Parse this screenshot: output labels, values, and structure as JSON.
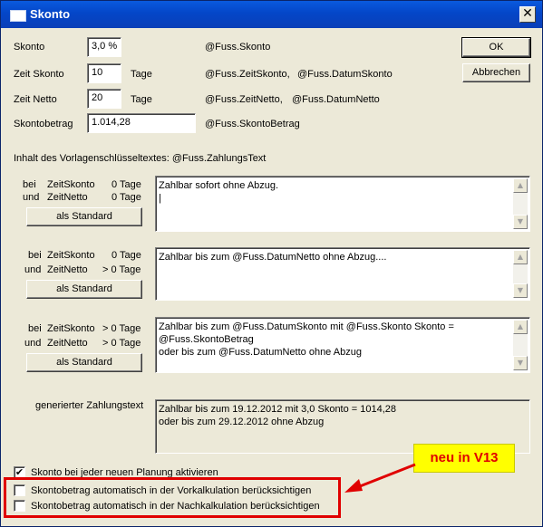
{
  "window": {
    "title": "Skonto",
    "close_glyph": "✕"
  },
  "fields": {
    "skonto": {
      "label": "Skonto",
      "value": "3,0 %",
      "var": "@Fuss.Skonto"
    },
    "zeit_skonto": {
      "label": "Zeit Skonto",
      "value": "10",
      "unit": "Tage",
      "var1": "@Fuss.ZeitSkonto,",
      "var2": "@Fuss.DatumSkonto"
    },
    "zeit_netto": {
      "label": "Zeit Netto",
      "value": "20",
      "unit": "Tage",
      "var1": "@Fuss.ZeitNetto,",
      "var2": "@Fuss.DatumNetto"
    },
    "skontobetrag": {
      "label": "Skontobetrag",
      "value": "1.014,28",
      "var": "@Fuss.SkontoBetrag"
    }
  },
  "buttons": {
    "ok": "OK",
    "cancel": "Abbrechen"
  },
  "inhalt_label": "Inhalt des Vorlagenschlüsseltextes: @Fuss.ZahlungsText",
  "blocks": [
    {
      "bei": "bei",
      "und": "und",
      "cond1_name": "ZeitSkonto",
      "cond1_value": "0 Tage",
      "cond2_name": "ZeitNetto",
      "cond2_value": "0 Tage",
      "button": "als Standard",
      "text": "Zahlbar sofort ohne Abzug.\n|"
    },
    {
      "bei": "bei",
      "und": "und",
      "cond1_name": "ZeitSkonto",
      "cond1_value": "0 Tage",
      "cond2_name": "ZeitNetto",
      "cond2_value": "> 0 Tage",
      "button": "als Standard",
      "text": "Zahlbar bis zum @Fuss.DatumNetto ohne Abzug...."
    },
    {
      "bei": "bei",
      "und": "und",
      "cond1_name": "ZeitSkonto",
      "cond1_value": "> 0 Tage",
      "cond2_name": "ZeitNetto",
      "cond2_value": "> 0 Tage",
      "button": "als Standard",
      "text": "Zahlbar bis zum @Fuss.DatumSkonto mit @Fuss.Skonto Skonto =\n@Fuss.SkontoBetrag\noder bis zum @Fuss.DatumNetto ohne Abzug"
    }
  ],
  "generated": {
    "label": "generierter Zahlungstext",
    "text": "Zahlbar bis zum 19.12.2012 mit 3,0 Skonto = 1014,28\noder bis zum 29.12.2012 ohne Abzug"
  },
  "checkboxes": [
    {
      "label": "Skonto bei jeder neuen Planung aktivieren",
      "checked": true,
      "mark": "✔"
    },
    {
      "label": "Skontobetrag automatisch in der Vorkalkulation berücksichtigen",
      "checked": false,
      "mark": ""
    },
    {
      "label": "Skontobetrag automatisch in der Nachkalkulation berücksichtigen",
      "checked": false,
      "mark": ""
    }
  ],
  "annotation": {
    "text": "neu in V13",
    "color": "#e00000",
    "bg": "#ffff00"
  },
  "scroll_glyphs": {
    "up": "▲",
    "down": "▼"
  }
}
